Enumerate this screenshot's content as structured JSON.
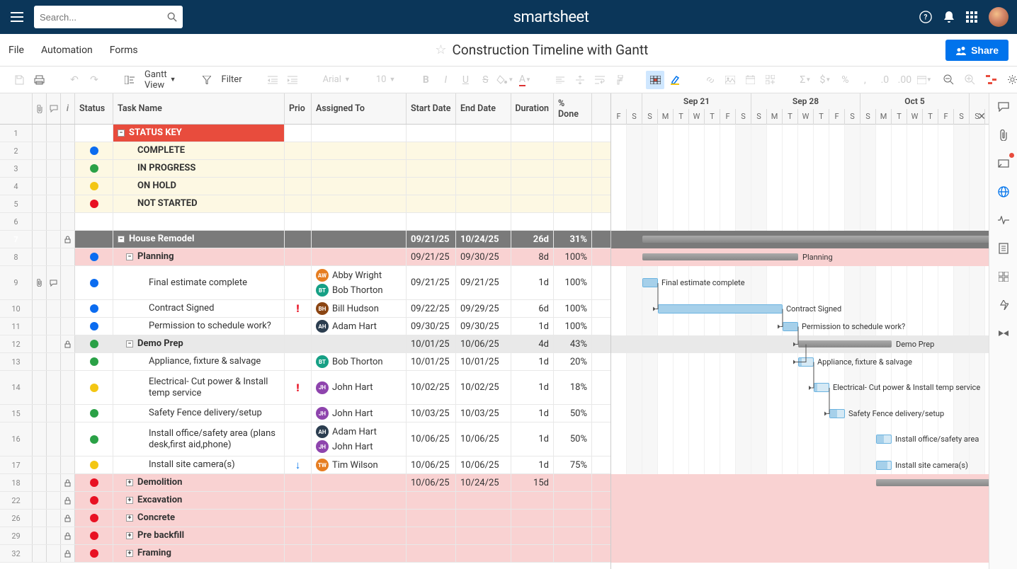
{
  "brand": "smartsheet",
  "search_placeholder": "Search...",
  "menu": {
    "file": "File",
    "automation": "Automation",
    "forms": "Forms"
  },
  "title": "Construction Timeline with Gantt",
  "share_label": "Share",
  "view_label": "Gantt View",
  "filter_label": "Filter",
  "font_family": "Arial",
  "font_size": "10",
  "columns": {
    "status": "Status",
    "task": "Task Name",
    "prio": "Prio",
    "assigned": "Assigned To",
    "start": "Start Date",
    "end": "End Date",
    "duration": "Duration",
    "done": "% Done"
  },
  "gantt_months": [
    {
      "label": "Sep 21",
      "days": 7
    },
    {
      "label": "Sep 28",
      "days": 7
    },
    {
      "label": "Oct 5",
      "days": 7
    }
  ],
  "gantt_day_letters": [
    "F",
    "S",
    "S",
    "M",
    "T",
    "W",
    "T",
    "F",
    "S",
    "S",
    "M",
    "T",
    "W",
    "T",
    "F",
    "S",
    "S",
    "M",
    "T",
    "W",
    "T",
    "F",
    "S",
    "S"
  ],
  "gantt_first_cols": 2,
  "rows": [
    {
      "num": "1",
      "type": "orange",
      "task": "STATUS KEY",
      "toggle": "-"
    },
    {
      "num": "2",
      "type": "cream",
      "dot": "blue",
      "task": "COMPLETE"
    },
    {
      "num": "3",
      "type": "cream",
      "dot": "green",
      "task": "IN PROGRESS"
    },
    {
      "num": "4",
      "type": "cream",
      "dot": "yellow",
      "task": "ON HOLD"
    },
    {
      "num": "5",
      "type": "cream",
      "dot": "red",
      "task": "NOT STARTED"
    },
    {
      "num": "6",
      "type": "blank"
    },
    {
      "num": "7",
      "type": "grey",
      "lock": true,
      "toggle": "-",
      "task": "House Remodel",
      "start": "09/21/25",
      "end": "10/24/25",
      "duration": "26d",
      "done": "31%",
      "gantt": {
        "kind": "summary",
        "start": 2,
        "span": 26,
        "label": ""
      }
    },
    {
      "num": "8",
      "type": "pink",
      "dot": "blue",
      "toggle": "-",
      "indent": 1,
      "task": "Planning",
      "start": "09/21/25",
      "end": "09/30/25",
      "duration": "8d",
      "done": "100%",
      "gantt": {
        "kind": "summary",
        "start": 2,
        "span": 10,
        "label": "Planning"
      }
    },
    {
      "num": "9",
      "tall": true,
      "dot": "blue",
      "attach": true,
      "comment": true,
      "indent": 3,
      "task": "Final estimate complete",
      "assignees": [
        {
          "init": "AW",
          "cls": "aw",
          "name": "Abby Wright"
        },
        {
          "init": "BT",
          "cls": "bt",
          "name": "Bob Thorton"
        }
      ],
      "start": "09/21/25",
      "end": "09/21/25",
      "duration": "1d",
      "done": "100%",
      "gantt": {
        "kind": "task",
        "start": 2,
        "span": 1,
        "label": "Final estimate complete",
        "progress": 100
      }
    },
    {
      "num": "10",
      "dot": "blue",
      "indent": 3,
      "prio": "!",
      "task": "Contract Signed",
      "assignees": [
        {
          "init": "BH",
          "cls": "bh",
          "name": "Bill Hudson"
        }
      ],
      "start": "09/22/25",
      "end": "09/29/25",
      "duration": "6d",
      "done": "100%",
      "gantt": {
        "kind": "task",
        "start": 3,
        "span": 8,
        "label": "Contract Signed",
        "progress": 100
      }
    },
    {
      "num": "11",
      "dot": "blue",
      "indent": 3,
      "task": "Permission to schedule work?",
      "assignees": [
        {
          "init": "AH",
          "cls": "ah",
          "name": "Adam Hart"
        }
      ],
      "start": "09/30/25",
      "end": "09/30/25",
      "duration": "1d",
      "done": "100%",
      "gantt": {
        "kind": "task",
        "start": 11,
        "span": 1,
        "label": "Permission to schedule work?",
        "progress": 100
      }
    },
    {
      "num": "12",
      "type": "ltgrey",
      "lock": true,
      "dot": "green",
      "toggle": "-",
      "indent": 1,
      "task": "Demo Prep",
      "start": "10/01/25",
      "end": "10/06/25",
      "duration": "4d",
      "done": "43%",
      "gantt": {
        "kind": "summary",
        "start": 12,
        "span": 6,
        "label": "Demo Prep"
      }
    },
    {
      "num": "13",
      "dot": "green",
      "indent": 3,
      "task": "Appliance, fixture & salvage",
      "assignees": [
        {
          "init": "BT",
          "cls": "bt",
          "name": "Bob Thorton"
        }
      ],
      "start": "10/01/25",
      "end": "10/01/25",
      "duration": "1d",
      "done": "20%",
      "gantt": {
        "kind": "task",
        "start": 12,
        "span": 1,
        "label": "Appliance, fixture & salvage",
        "progress": 20
      }
    },
    {
      "num": "14",
      "tall": true,
      "dot": "yellow",
      "indent": 3,
      "prio": "!",
      "task": "Electrical- Cut power & Install temp service",
      "assignees": [
        {
          "init": "JH",
          "cls": "jh",
          "name": "John Hart"
        }
      ],
      "start": "10/02/25",
      "end": "10/02/25",
      "duration": "1d",
      "done": "18%",
      "gantt": {
        "kind": "task",
        "start": 13,
        "span": 1,
        "label": "Electrical- Cut power & Install temp service",
        "progress": 18
      }
    },
    {
      "num": "15",
      "dot": "green",
      "indent": 3,
      "task": "Safety Fence delivery/setup",
      "assignees": [
        {
          "init": "JH",
          "cls": "jh",
          "name": "John Hart"
        }
      ],
      "start": "10/03/25",
      "end": "10/03/25",
      "duration": "1d",
      "done": "50%",
      "gantt": {
        "kind": "task",
        "start": 14,
        "span": 1,
        "label": "Safety Fence delivery/setup",
        "progress": 50
      }
    },
    {
      "num": "16",
      "tall": true,
      "dot": "green",
      "indent": 3,
      "task": "Install office/safety area (plans desk,first aid,phone)",
      "assignees": [
        {
          "init": "AH",
          "cls": "ah",
          "name": "Adam Hart"
        },
        {
          "init": "JH",
          "cls": "jh",
          "name": "John Hart"
        }
      ],
      "start": "10/06/25",
      "end": "10/06/25",
      "duration": "1d",
      "done": "50%",
      "gantt": {
        "kind": "task",
        "start": 17,
        "span": 1,
        "label": "Install office/safety area",
        "progress": 50
      }
    },
    {
      "num": "17",
      "dot": "yellow",
      "indent": 3,
      "prio": "down",
      "task": "Install site camera(s)",
      "assignees": [
        {
          "init": "TW",
          "cls": "tw",
          "name": "Tim Wilson"
        }
      ],
      "start": "10/06/25",
      "end": "10/06/25",
      "duration": "1d",
      "done": "75%",
      "gantt": {
        "kind": "task",
        "start": 17,
        "span": 1,
        "label": "Install site camera(s)",
        "progress": 75
      }
    },
    {
      "num": "18",
      "type": "pink",
      "lock": true,
      "dot": "red",
      "toggle": "+",
      "indent": 1,
      "task": "Demolition",
      "start": "10/06/25",
      "end": "10/24/25",
      "duration": "15d",
      "gantt": {
        "kind": "summary",
        "start": 17,
        "span": 11,
        "label": ""
      }
    },
    {
      "num": "22",
      "type": "pink",
      "lock": true,
      "dot": "red",
      "toggle": "+",
      "indent": 1,
      "task": "Excavation"
    },
    {
      "num": "26",
      "type": "pink",
      "lock": true,
      "dot": "red",
      "toggle": "+",
      "indent": 1,
      "task": "Concrete"
    },
    {
      "num": "29",
      "type": "pink",
      "lock": true,
      "dot": "red",
      "toggle": "+",
      "indent": 1,
      "task": "Pre backfill"
    },
    {
      "num": "32",
      "type": "pink",
      "lock": true,
      "dot": "red",
      "toggle": "+",
      "indent": 1,
      "task": "Framing"
    }
  ],
  "day_width": 22
}
